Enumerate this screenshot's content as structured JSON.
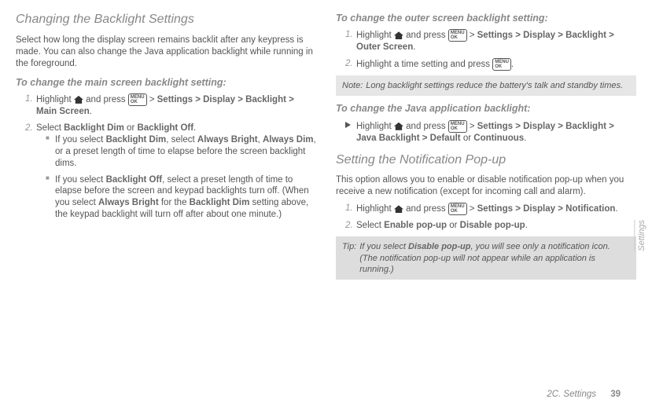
{
  "left": {
    "title": "Changing the Backlight Settings",
    "intro": "Select how long the display screen remains backlit after any keypress is made. You can also change the Java application backlight while running in the foreground.",
    "sub1": "To change the main screen backlight setting:",
    "step1_prefix": "Highlight ",
    "step1_mid": " and press ",
    "step1_gt1": " > ",
    "step1_settings": "Settings",
    "step1_gt2": " > ",
    "step1_display": "Display",
    "step1_gt3": " > ",
    "step1_backlight": "Backlight",
    "step1_gt4": " > ",
    "step1_mainscreen": "Main Screen",
    "step1_period": ".",
    "step2_prefix": "Select ",
    "step2_dim": "Backlight Dim",
    "step2_or": " or ",
    "step2_off": "Backlight Off",
    "step2_period": ".",
    "sub_a_prefix": "If you select ",
    "sub_a_dim": "Backlight Dim",
    "sub_a_mid1": ", select ",
    "sub_a_bright": "Always Bright",
    "sub_a_mid2": ", ",
    "sub_a_adim": "Always Dim",
    "sub_a_tail": ", or a preset length of time to elapse before the screen backlight dims.",
    "sub_b_prefix": "If you select ",
    "sub_b_off": "Backlight Off",
    "sub_b_mid1": ", select a preset length of time to elapse before the screen and keypad backlights turn off. (When you select ",
    "sub_b_bright": "Always Bright",
    "sub_b_mid2": " for the ",
    "sub_b_dim": "Backlight Dim",
    "sub_b_tail": " setting above, the keypad backlight will turn off after about one minute.)"
  },
  "right": {
    "sub1": "To change the outer screen backlight setting:",
    "r1_prefix": "Highlight ",
    "r1_mid": " and press ",
    "r1_gt": " > ",
    "r1_settings": "Settings",
    "r1_display": "Display",
    "r1_backlight": "Backlight",
    "r1_outer": "Outer Screen",
    "r1_period": ".",
    "r2_text": "Highlight a time setting and press ",
    "r2_period": ".",
    "note_label": "Note:",
    "note_text": "Long backlight settings reduce the battery's talk and standby times.",
    "sub2": "To change the Java application backlight:",
    "java_prefix": "Highlight ",
    "java_mid": " and press ",
    "java_settings": "Settings",
    "java_display": "Display",
    "java_backlight": "Backlight",
    "java_jb": "Java Backlight",
    "java_default": "Default",
    "java_or": " or ",
    "java_cont": "Continuous",
    "java_period": ".",
    "title2": "Setting the Notification Pop-up",
    "notif_intro": "This option allows you to enable or disable notification pop-up when you receive a new notification (except for incoming call and alarm).",
    "n1_prefix": "Highlight ",
    "n1_mid": " and press ",
    "n1_settings": "Settings",
    "n1_display": "Display",
    "n1_notif": "Notification",
    "n1_period": ".",
    "n2_prefix": "Select ",
    "n2_enable": "Enable pop-up",
    "n2_or": " or ",
    "n2_disable": "Disable pop-up",
    "n2_period": ".",
    "tip_label": "Tip:",
    "tip_prefix": "If you select ",
    "tip_disable": "Disable pop-up",
    "tip_tail": ", you will see only a notification icon. (The notification pop-up will not appear while an application is running.)"
  },
  "menu_label": "MENU\nOK",
  "footer_section": "2C. Settings",
  "footer_page": "39",
  "side_tab": "Settings"
}
